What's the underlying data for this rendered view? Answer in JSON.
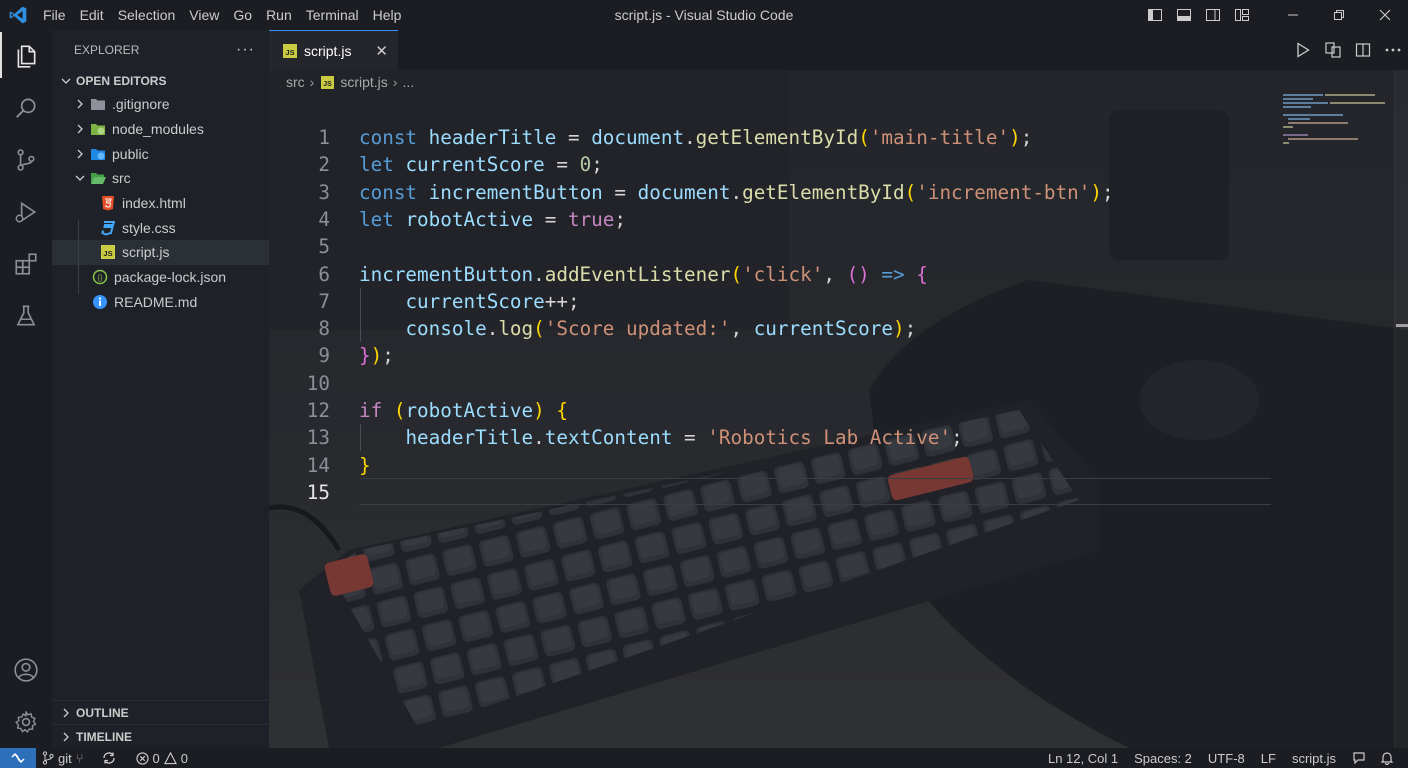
{
  "app": {
    "window_title": "script.js - Visual Studio Code"
  },
  "menu": [
    "File",
    "Edit",
    "Selection",
    "View",
    "Go",
    "Run",
    "Terminal",
    "Help"
  ],
  "sidebar": {
    "title": "EXPLORER",
    "more": "···",
    "open_editors": "OPEN EDITORS",
    "items": [
      {
        "label": ".gitignore",
        "type": "folder",
        "icon": "folder-icon",
        "color": "#8d9199"
      },
      {
        "label": "node_modules",
        "type": "folder",
        "icon": "node-folder-icon",
        "color": "#8bc34a"
      },
      {
        "label": "public",
        "type": "folder",
        "icon": "public-folder-icon",
        "color": "#42a5f5"
      },
      {
        "label": "src",
        "type": "folder-open",
        "icon": "src-folder-icon",
        "color": "#4caf50"
      },
      {
        "label": "index.html",
        "type": "file",
        "icon": "html5-icon",
        "color": "#e44d26"
      },
      {
        "label": "style.css",
        "type": "file",
        "icon": "css3-icon",
        "color": "#42a5f5"
      },
      {
        "label": "script.js",
        "type": "file",
        "icon": "javascript-icon",
        "color": "#cbcb41",
        "selected": true
      },
      {
        "label": "package-lock.json",
        "type": "file",
        "icon": "npm-json-icon",
        "color": "#8bc34a"
      },
      {
        "label": "README.md",
        "type": "file",
        "icon": "info-icon",
        "color": "#3794ff"
      }
    ],
    "outline": "OUTLINE",
    "timeline": "TIMELINE"
  },
  "editor": {
    "tab_label": "script.js",
    "tab_icon": "JS",
    "breadcrumb": [
      "src",
      "script.js",
      "..."
    ],
    "active_line": 15,
    "lines": [
      {
        "n": "1",
        "t": [
          [
            "kw",
            "const"
          ],
          [
            "op",
            " "
          ],
          [
            "var",
            "headerTitle"
          ],
          [
            "op",
            " = "
          ],
          [
            "var",
            "document"
          ],
          [
            "op",
            "."
          ],
          [
            "fn",
            "getElementById"
          ],
          [
            "br1",
            "("
          ],
          [
            "str",
            "'main-title'"
          ],
          [
            "br1",
            ")"
          ],
          [
            "op",
            ";"
          ]
        ]
      },
      {
        "n": "2",
        "t": [
          [
            "kw",
            "let"
          ],
          [
            "op",
            " "
          ],
          [
            "var",
            "currentScore"
          ],
          [
            "op",
            " = "
          ],
          [
            "num",
            "0"
          ],
          [
            "op",
            ";"
          ]
        ]
      },
      {
        "n": "3",
        "t": [
          [
            "kw",
            "const"
          ],
          [
            "op",
            " "
          ],
          [
            "var",
            "incrementButton"
          ],
          [
            "op",
            " = "
          ],
          [
            "var",
            "document"
          ],
          [
            "op",
            "."
          ],
          [
            "fn",
            "getElementById"
          ],
          [
            "br1",
            "("
          ],
          [
            "str",
            "'increment-btn'"
          ],
          [
            "br1",
            ")"
          ],
          [
            "op",
            ";"
          ]
        ]
      },
      {
        "n": "4",
        "t": [
          [
            "kw",
            "let"
          ],
          [
            "op",
            " "
          ],
          [
            "var",
            "robotActive"
          ],
          [
            "op",
            " = "
          ],
          [
            "ctl",
            "true"
          ],
          [
            "op",
            ";"
          ]
        ]
      },
      {
        "n": "5",
        "t": []
      },
      {
        "n": "6",
        "t": [
          [
            "var",
            "incrementButton"
          ],
          [
            "op",
            "."
          ],
          [
            "fn",
            "addEventListener"
          ],
          [
            "br1",
            "("
          ],
          [
            "str",
            "'click'"
          ],
          [
            "op",
            ", "
          ],
          [
            "br2",
            "()"
          ],
          [
            "op",
            " "
          ],
          [
            "kw",
            "=>"
          ],
          [
            "op",
            " "
          ],
          [
            "br2",
            "{"
          ]
        ]
      },
      {
        "n": "7",
        "t": [
          [
            "op",
            "    "
          ],
          [
            "var",
            "currentScore"
          ],
          [
            "op",
            "++;"
          ]
        ]
      },
      {
        "n": "8",
        "t": [
          [
            "op",
            "    "
          ],
          [
            "var",
            "console"
          ],
          [
            "op",
            "."
          ],
          [
            "fn",
            "log"
          ],
          [
            "br1",
            "("
          ],
          [
            "str",
            "'Score updated:'"
          ],
          [
            "op",
            ", "
          ],
          [
            "var",
            "currentScore"
          ],
          [
            "br1",
            ")"
          ],
          [
            "op",
            ";"
          ]
        ]
      },
      {
        "n": "9",
        "t": [
          [
            "br2",
            "}"
          ],
          [
            "br1",
            ")"
          ],
          [
            "op",
            ";"
          ]
        ]
      },
      {
        "n": "10",
        "t": []
      },
      {
        "n": "12",
        "t": [
          [
            "ctl",
            "if"
          ],
          [
            "op",
            " "
          ],
          [
            "br1",
            "("
          ],
          [
            "var",
            "robotActive"
          ],
          [
            "br1",
            ")"
          ],
          [
            "op",
            " "
          ],
          [
            "br1",
            "{"
          ]
        ]
      },
      {
        "n": "13",
        "t": [
          [
            "op",
            "    "
          ],
          [
            "var",
            "headerTitle"
          ],
          [
            "op",
            "."
          ],
          [
            "var",
            "textContent"
          ],
          [
            "op",
            " = "
          ],
          [
            "str",
            "'Robotics Lab Active'"
          ],
          [
            "op",
            ";"
          ]
        ]
      },
      {
        "n": "14",
        "t": [
          [
            "br1",
            "}"
          ]
        ]
      },
      {
        "n": "15",
        "t": []
      }
    ]
  },
  "statusbar": {
    "branch": "git",
    "errors": "0",
    "warnings": "0",
    "position": "Ln 12, Col 1",
    "spaces": "Spaces: 2",
    "encoding": "UTF-8",
    "eol": "LF",
    "language": "script.js"
  },
  "colors": {
    "accent": "#3794ff",
    "remote": "#2d6fb8",
    "keyword": "#569cd6",
    "control": "#c586c0",
    "variable": "#9cdcfe",
    "function": "#dcdcaa",
    "string": "#ce9178",
    "number": "#b5cea8"
  }
}
